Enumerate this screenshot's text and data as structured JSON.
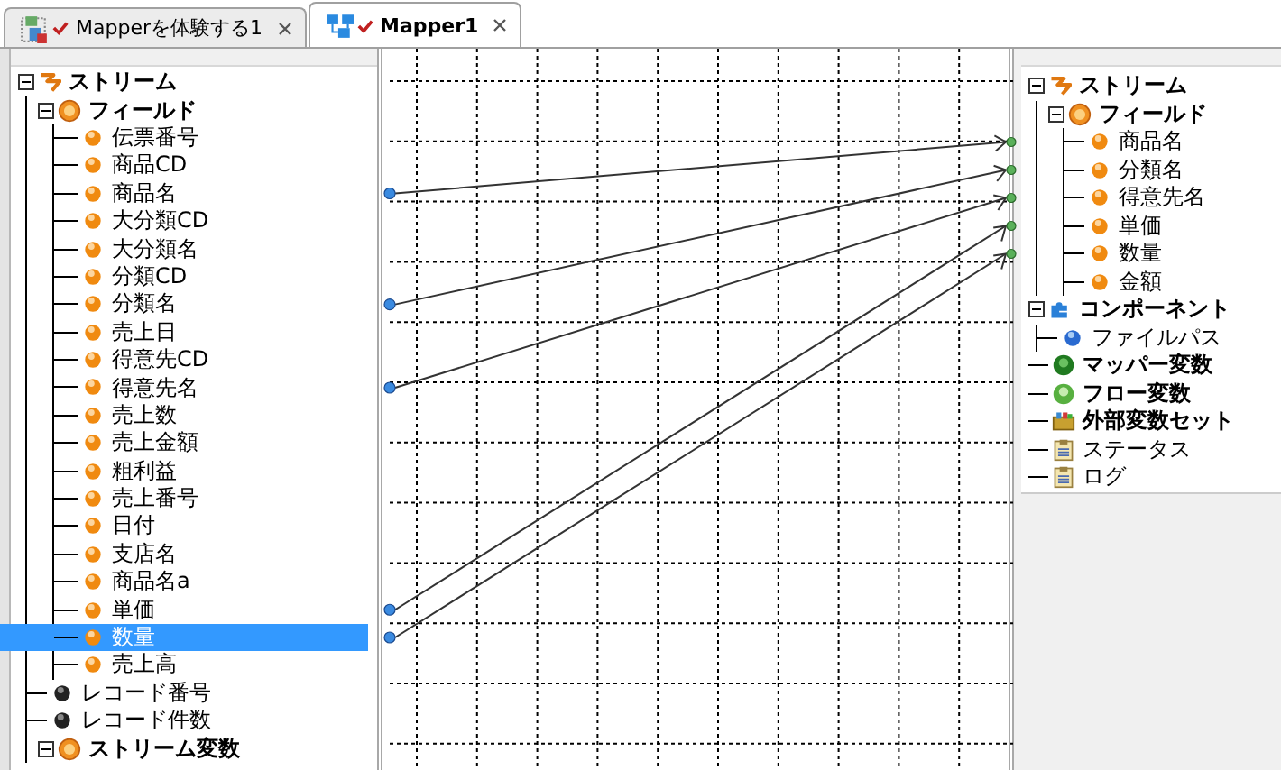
{
  "tabs": [
    {
      "label": "Mapperを体験する1",
      "kind": "flow",
      "selected": false
    },
    {
      "label": "Mapper1",
      "kind": "mapper",
      "selected": true
    }
  ],
  "source_tree": [
    {
      "label": "ストリーム",
      "kind": "stream",
      "expanded": true,
      "selected": false,
      "children": [
        {
          "label": "フィールド",
          "kind": "field-group",
          "expanded": true,
          "selected": false,
          "children": [
            {
              "label": "伝票番号",
              "kind": "field",
              "selected": false,
              "linked": false
            },
            {
              "label": "商品CD",
              "kind": "field",
              "selected": false,
              "linked": false
            },
            {
              "label": "商品名",
              "kind": "field",
              "selected": false,
              "linked": true
            },
            {
              "label": "大分類CD",
              "kind": "field",
              "selected": false,
              "linked": false
            },
            {
              "label": "大分類名",
              "kind": "field",
              "selected": false,
              "linked": false
            },
            {
              "label": "分類CD",
              "kind": "field",
              "selected": false,
              "linked": false
            },
            {
              "label": "分類名",
              "kind": "field",
              "selected": false,
              "linked": true
            },
            {
              "label": "売上日",
              "kind": "field",
              "selected": false,
              "linked": false
            },
            {
              "label": "得意先CD",
              "kind": "field",
              "selected": false,
              "linked": false
            },
            {
              "label": "得意先名",
              "kind": "field",
              "selected": false,
              "linked": true
            },
            {
              "label": "売上数",
              "kind": "field",
              "selected": false,
              "linked": false
            },
            {
              "label": "売上金額",
              "kind": "field",
              "selected": false,
              "linked": false
            },
            {
              "label": "粗利益",
              "kind": "field",
              "selected": false,
              "linked": false
            },
            {
              "label": "売上番号",
              "kind": "field",
              "selected": false,
              "linked": false
            },
            {
              "label": "日付",
              "kind": "field",
              "selected": false,
              "linked": false
            },
            {
              "label": "支店名",
              "kind": "field",
              "selected": false,
              "linked": false
            },
            {
              "label": "商品名a",
              "kind": "field",
              "selected": false,
              "linked": false
            },
            {
              "label": "単価",
              "kind": "field",
              "selected": false,
              "linked": true
            },
            {
              "label": "数量",
              "kind": "field",
              "selected": true,
              "linked": true
            },
            {
              "label": "売上高",
              "kind": "field",
              "selected": false,
              "linked": false
            }
          ]
        },
        {
          "label": "レコード番号",
          "kind": "record",
          "selected": false
        },
        {
          "label": "レコード件数",
          "kind": "record",
          "selected": false
        },
        {
          "label": "ストリーム変数",
          "kind": "variable-group",
          "expanded": true,
          "selected": false
        }
      ]
    }
  ],
  "target_tree": [
    {
      "label": "ストリーム",
      "kind": "stream",
      "expanded": true,
      "selected": false,
      "children": [
        {
          "label": "フィールド",
          "kind": "field-group",
          "expanded": true,
          "selected": false,
          "children": [
            {
              "label": "商品名",
              "kind": "field",
              "selected": false,
              "linked": true
            },
            {
              "label": "分類名",
              "kind": "field",
              "selected": false,
              "linked": true
            },
            {
              "label": "得意先名",
              "kind": "field",
              "selected": false,
              "linked": true
            },
            {
              "label": "単価",
              "kind": "field",
              "selected": false,
              "linked": true
            },
            {
              "label": "数量",
              "kind": "field",
              "selected": false,
              "linked": true
            },
            {
              "label": "金額",
              "kind": "field",
              "selected": false,
              "linked": false
            }
          ]
        }
      ]
    },
    {
      "label": "コンポーネント",
      "kind": "component",
      "expanded": true,
      "selected": false,
      "children": [
        {
          "label": "ファイルパス",
          "kind": "path",
          "selected": false
        }
      ]
    },
    {
      "label": "マッパー変数",
      "kind": "mapper-var",
      "selected": false
    },
    {
      "label": "フロー変数",
      "kind": "flow-var",
      "selected": false
    },
    {
      "label": "外部変数セット",
      "kind": "external-set",
      "selected": false
    },
    {
      "label": "ステータス",
      "kind": "status",
      "selected": false
    },
    {
      "label": "ログ",
      "kind": "log",
      "selected": false
    }
  ]
}
